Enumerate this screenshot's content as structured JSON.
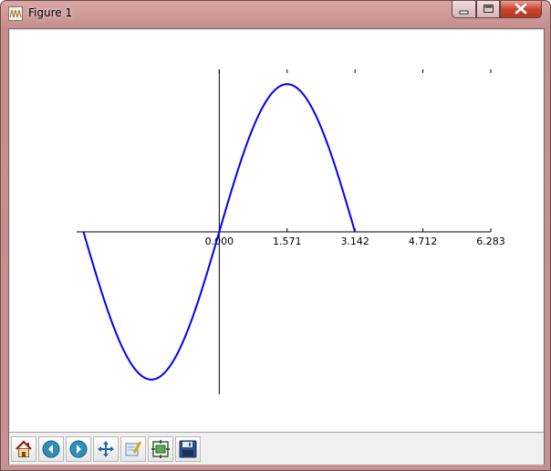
{
  "window": {
    "title": "Figure 1",
    "icon": "matplotlib-figure-icon",
    "controls": [
      "minimize-icon",
      "maximize-icon",
      "close-icon"
    ]
  },
  "toolbar": {
    "buttons": [
      {
        "name": "home-button",
        "icon": "home-icon"
      },
      {
        "name": "back-button",
        "icon": "back-arrow-icon"
      },
      {
        "name": "forward-button",
        "icon": "forward-arrow-icon"
      },
      {
        "name": "pan-button",
        "icon": "move-arrows-icon"
      },
      {
        "name": "zoom-button",
        "icon": "zoom-rectangle-icon"
      },
      {
        "name": "subplots-button",
        "icon": "configure-subplots-icon"
      },
      {
        "name": "save-button",
        "icon": "floppy-disk-icon"
      }
    ]
  },
  "chart_data": {
    "type": "line",
    "function": "sin(x)",
    "x_range": [
      -3.142,
      3.142
    ],
    "xlim": [
      -3.3,
      6.283
    ],
    "ylim": [
      -1.1,
      1.1
    ],
    "axes_position": "centered at origin",
    "xticks": [
      "0.000",
      "1.571",
      "3.142",
      "4.712",
      "6.283"
    ],
    "series": [
      {
        "color": "#0000ff",
        "x": [
          -3.142,
          -2.749,
          -2.356,
          -1.963,
          -1.571,
          -1.178,
          -0.785,
          -0.393,
          0.0,
          0.393,
          0.785,
          1.178,
          1.571,
          1.963,
          2.356,
          2.749,
          3.142
        ],
        "y": [
          0.0,
          -0.383,
          -0.707,
          -0.924,
          -1.0,
          -0.924,
          -0.707,
          -0.383,
          0.0,
          0.383,
          0.707,
          0.924,
          1.0,
          0.924,
          0.707,
          0.383,
          0.0
        ]
      }
    ],
    "grid": false,
    "legend": "none"
  }
}
